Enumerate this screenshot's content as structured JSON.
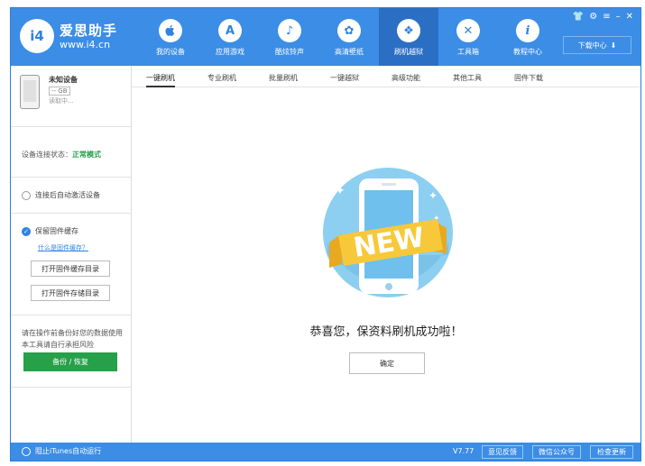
{
  "app": {
    "logo_badge": "i4",
    "logo_name": "爱思助手",
    "logo_url": "www.i4.cn"
  },
  "nav": [
    {
      "label": "我的设备",
      "icon": "apple-icon",
      "glyph": ""
    },
    {
      "label": "应用游戏",
      "icon": "app-store-icon",
      "glyph": "A"
    },
    {
      "label": "酷炫铃声",
      "icon": "bell-icon",
      "glyph": "♪"
    },
    {
      "label": "高清壁纸",
      "icon": "flower-icon",
      "glyph": "✿"
    },
    {
      "label": "刷机越狱",
      "icon": "box-icon",
      "glyph": "❖"
    },
    {
      "label": "工具箱",
      "icon": "tools-icon",
      "glyph": "✕"
    },
    {
      "label": "教程中心",
      "icon": "info-icon",
      "glyph": "i"
    }
  ],
  "window_controls": {
    "shirt": "👕",
    "gear": "⚙",
    "menu": "≡",
    "minimize": "–",
    "close": "✕"
  },
  "download_center": "下载中心",
  "download_glyph": "⬇",
  "device": {
    "name": "未知设备",
    "capacity": "-- GB",
    "status": "读取中..."
  },
  "connection": {
    "label": "设备连接状态：",
    "value": "正常模式"
  },
  "auto_activate": "连接后自动激活设备",
  "keep_cache": "保留固件缓存",
  "what_cache": "什么是固件缓存？",
  "check_glyph": "✓",
  "buttons": {
    "open_cache_dir": "打开固件缓存目录",
    "open_storage_dir": "打开固件存储目录",
    "backup_restore": "备份 / 恢复",
    "ok": "确定"
  },
  "note": "请在操作前备份好您的数据使用本工具请自行承担风险",
  "tabs": [
    "一键刷机",
    "专业刷机",
    "批量刷机",
    "一键越狱",
    "高级功能",
    "其他工具",
    "固件下载"
  ],
  "active_tab": 0,
  "illustration": {
    "badge_text": "NEW"
  },
  "success_message": "恭喜您，保资料刷机成功啦！",
  "footer": {
    "itunes_block": "阻止iTunes自动运行",
    "version": "V7.77",
    "feedback": "意见反馈",
    "wechat": "微信公众号",
    "check_update": "检查更新"
  },
  "colors": {
    "header_blue": "#3b8de6",
    "active_nav": "#2a6fc4",
    "green": "#27a04a",
    "circle_bg": "#8ccff0",
    "ribbon": "#f7c93a"
  }
}
